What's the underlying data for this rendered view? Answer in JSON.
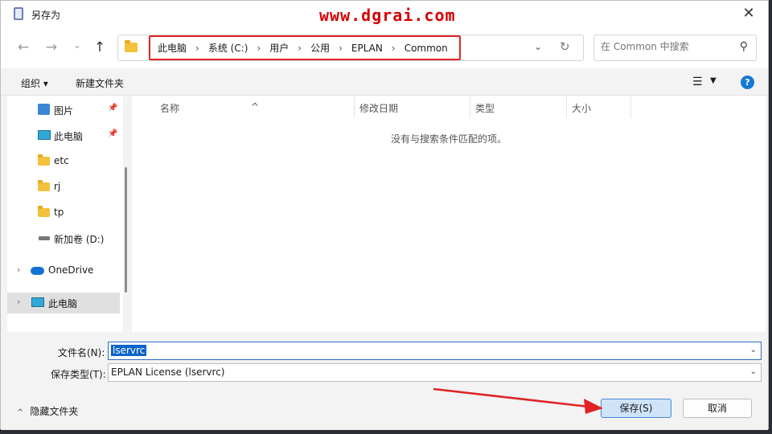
{
  "window": {
    "title": "另存为",
    "watermark": "www.dgrai.com",
    "close_glyph": "✕"
  },
  "nav": {
    "back_glyph": "←",
    "forward_glyph": "→",
    "recent_glyph": "⌄",
    "up_glyph": "↑",
    "breadcrumbs": [
      "此电脑",
      "系统 (C:)",
      "用户",
      "公用",
      "EPLAN",
      "Common"
    ],
    "separator": "›",
    "dropdown_glyph": "⌄",
    "refresh_glyph": "↻",
    "search_placeholder": "在 Common 中搜索",
    "search_glyph": "⚲"
  },
  "toolbar": {
    "organize": "组织 ▾",
    "new_folder": "新建文件夹",
    "view_glyph": "☰",
    "view_dd": "▼",
    "help": "?"
  },
  "sidebar": {
    "pin_glyph": "📌",
    "items": [
      {
        "label": "图片"
      },
      {
        "label": "此电脑"
      },
      {
        "label": "etc"
      },
      {
        "label": "rj"
      },
      {
        "label": "tp"
      },
      {
        "label": "新加卷 (D:)"
      },
      {
        "label": "OneDrive"
      },
      {
        "label": "此电脑"
      }
    ],
    "chevron": "›"
  },
  "filelist": {
    "columns": [
      "名称",
      "修改日期",
      "类型",
      "大小"
    ],
    "sort_glyph": "^",
    "empty_message": "没有与搜索条件匹配的项。"
  },
  "form": {
    "filename_label": "文件名(N):",
    "filename_value": "lservrc",
    "filetype_label": "保存类型(T):",
    "filetype_value": "EPLAN License (lservrc)",
    "dd_glyph": "⌄"
  },
  "footer": {
    "hide_folders": "隐藏文件夹",
    "caret": "^",
    "save": "保存(S)",
    "cancel": "取消"
  },
  "colors": {
    "highlight": "#e02424",
    "accent": "#0a64c8"
  }
}
